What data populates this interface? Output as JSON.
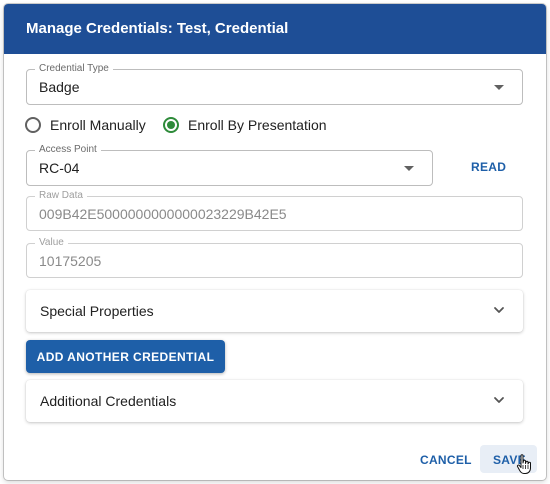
{
  "dialog": {
    "title": "Manage Credentials: Test, Credential"
  },
  "credential_type": {
    "label": "Credential Type",
    "value": "Badge"
  },
  "enroll": {
    "manual_label": "Enroll Manually",
    "presentation_label": "Enroll By Presentation",
    "selected": "Enroll By Presentation"
  },
  "access_point": {
    "label": "Access Point",
    "value": "RC-04",
    "read_label": "READ"
  },
  "raw_data": {
    "label": "Raw Data",
    "value": "009B42E5000000000000023229B42E5"
  },
  "value_field": {
    "label": "Value",
    "value": "10175205"
  },
  "panels": {
    "special_properties": "Special Properties",
    "additional_credentials": "Additional Credentials"
  },
  "actions": {
    "add_another": "ADD ANOTHER CREDENTIAL",
    "cancel": "CANCEL",
    "save": "SAVE"
  },
  "colors": {
    "header": "#1e4e96",
    "primary": "#1e5fa8",
    "radio_selected": "#2e8b3a"
  },
  "icons": {
    "dropdown": "caret-down-icon",
    "panel_toggle": "chevron-down-icon",
    "cursor": "hand-pointer-icon"
  }
}
